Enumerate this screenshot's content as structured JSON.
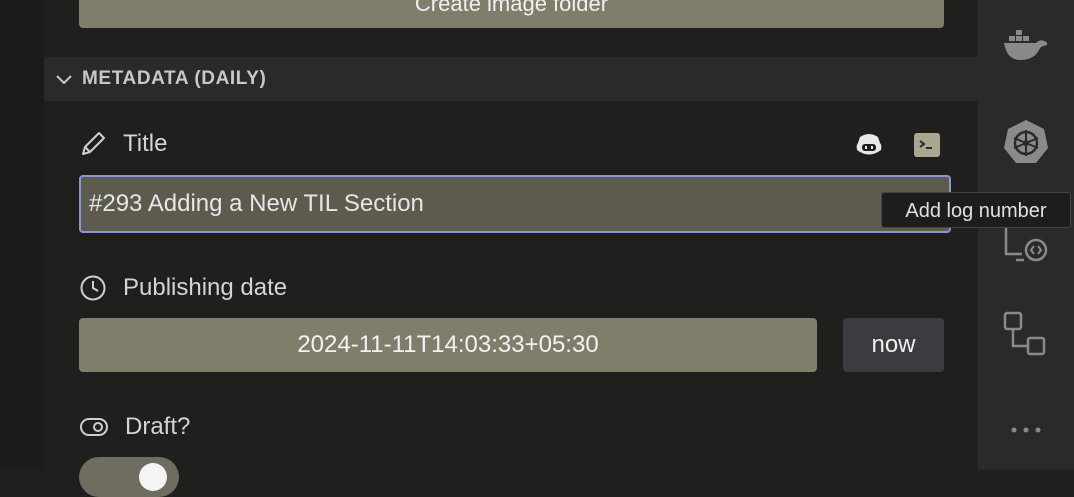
{
  "top_button": {
    "label": "Create image folder"
  },
  "section": {
    "title": "METADATA (DAILY)"
  },
  "title_field": {
    "label": "Title",
    "value": "#293 Adding a New TIL Section"
  },
  "publishing_date": {
    "label": "Publishing date",
    "value": "2024-11-11T14:03:33+05:30",
    "now_label": "now"
  },
  "draft": {
    "label": "Draft?",
    "enabled": true
  },
  "tooltip": {
    "text": "Add log number"
  },
  "activity_bar": {
    "icons": [
      "docker-icon",
      "kubernetes-icon",
      "remote-explorer-icon",
      "source-control-graph-icon",
      "more-icon"
    ]
  },
  "colors": {
    "accent_border": "#8a95d6",
    "input_bg": "#5d5b4e",
    "button_bg": "#807e6a"
  }
}
